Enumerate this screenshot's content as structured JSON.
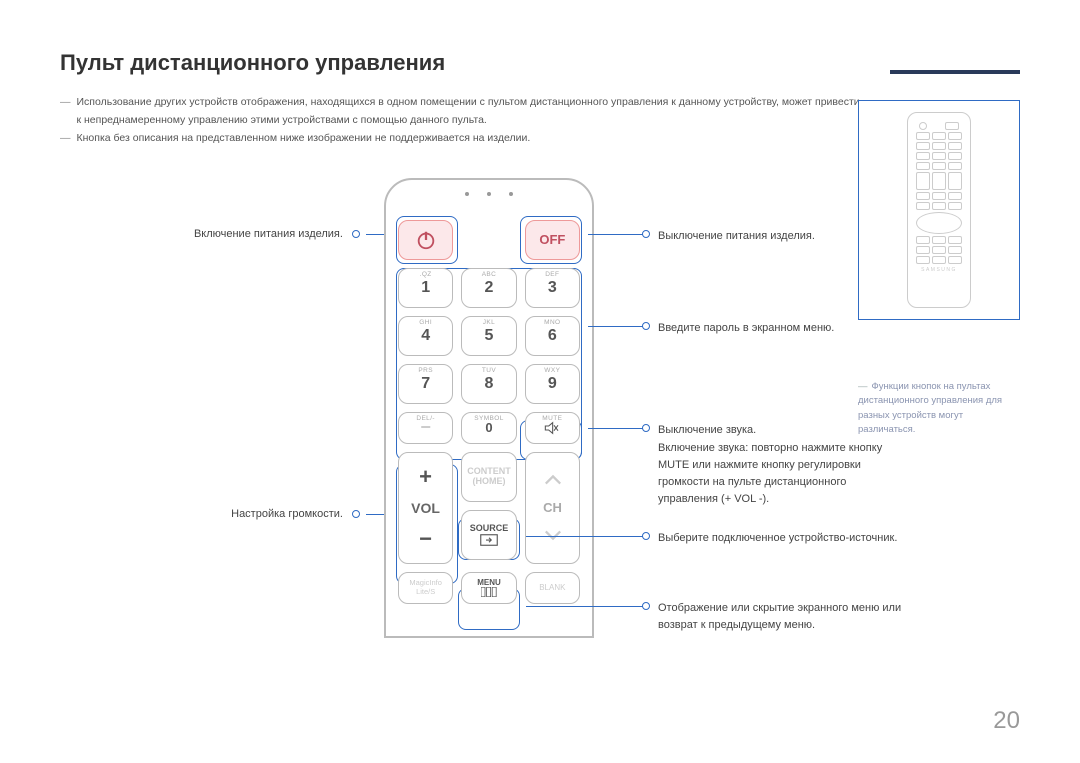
{
  "page": {
    "title": "Пульт дистанционного управления",
    "number": "20",
    "notes": [
      "Использование других устройств отображения, находящихся в одном помещении с пультом дистанционного управления к данному устройству, может привести к непреднамеренному управлению этими устройствами с помощью данного пульта.",
      "Кнопка без описания на представленном ниже изображении не поддерживается на изделии."
    ]
  },
  "left": {
    "power_on": "Включение питания изделия.",
    "volume": "Настройка громкости."
  },
  "right": {
    "power_off": "Выключение питания изделия.",
    "keypad": "Введите пароль в экранном меню.",
    "mute": "Выключение звука.",
    "mute2": "Включение звука: повторно нажмите кнопку MUTE или нажмите кнопку регулировки громкости на пульте дистанционного управления (+ VOL -).",
    "source": "Выберите подключенное устройство-источник.",
    "menu": "Отображение или скрытие экранного меню или возврат к предыдущему меню."
  },
  "side_note": "Функции кнопок на пультах дистанционного управления для разных устройств могут различаться.",
  "remote": {
    "off": "OFF",
    "keys": {
      "k1": "1",
      "k2": "2",
      "k3": "3",
      "k4": "4",
      "k5": "5",
      "k6": "6",
      "k7": "7",
      "k8": "8",
      "k9": "9",
      "k0": "0"
    },
    "sups": {
      "s1": ".QZ",
      "s2": "ABC",
      "s3": "DEF",
      "s4": "GHI",
      "s5": "JKL",
      "s6": "MNO",
      "s7": "PRS",
      "s8": "TUV",
      "s9": "WXY",
      "del": "DEL/-",
      "sym": "SYMBOL",
      "mute": "MUTE"
    },
    "vol": "VOL",
    "ch": "CH",
    "content": "CONTENT",
    "home": "(HOME)",
    "source": "SOURCE",
    "menu": "MENU",
    "magicinfo": "MagicInfo",
    "lites": "Lite/S",
    "blank": "BLANK",
    "brand": "SAMSUNG"
  }
}
